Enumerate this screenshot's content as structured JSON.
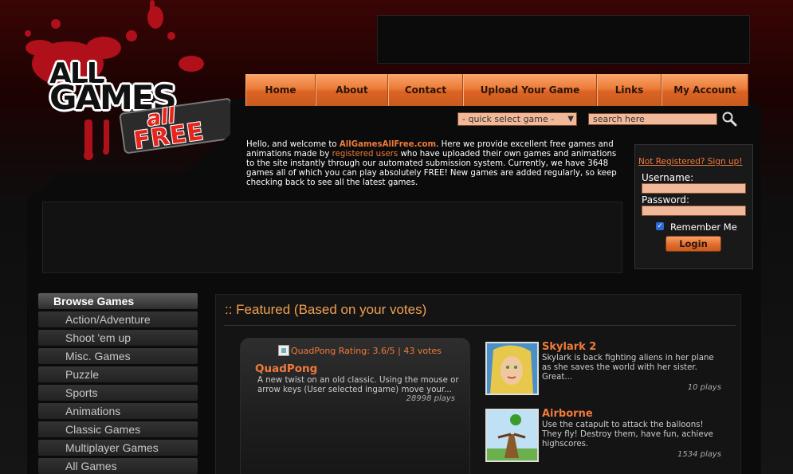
{
  "logo": {
    "line1": "ALL",
    "line2": "GAMES",
    "badge_line1": "all",
    "badge_line2": "FREE"
  },
  "nav": {
    "items": [
      "Home",
      "About",
      "Contact",
      "Upload Your Game",
      "Links",
      "My Account"
    ]
  },
  "quick_select": {
    "value": "- quick select game -"
  },
  "search": {
    "placeholder": "search here"
  },
  "welcome": {
    "t1": "Hello, and welcome to ",
    "site": "AllGamesAllFree.com",
    "t2": ". Here we provide excellent free games and animations made by ",
    "registered": "registered users",
    "t3": " who have uploaded their own games and animations to the site instantly through our automated submission system. Currently, we have 3648 games all of which you can play absolutely FREE! New games are added regularly, so keep checking back to see all the latest games."
  },
  "login": {
    "register_link": "Not Registered? Sign up!",
    "username_label": "Username:",
    "password_label": "Password:",
    "remember_label": "Remember Me",
    "login_button": "Login"
  },
  "browse": {
    "title": "Browse Games",
    "items": [
      "Action/Adventure",
      "Shoot 'em up",
      "Misc. Games",
      "Puzzle",
      "Sports",
      "Animations",
      "Classic Games",
      "Multiplayer Games",
      "All Games"
    ]
  },
  "featured": {
    "title": ":: Featured (Based on your votes)",
    "main": {
      "img_alt": "QuadPong",
      "rating": "Rating: 3.6/5 | 43 votes",
      "name": "QuadPong",
      "desc": "A new twist on an old classic. Using the mouse or arrow keys (User selected ingame) move your...",
      "plays": "28998 plays"
    },
    "games": [
      {
        "name": "Skylark 2",
        "desc": "Skylark is back fighting aliens in her plane as she saves the world with her sister. Great...",
        "plays": "10 plays"
      },
      {
        "name": "Airborne",
        "desc": "Use the catapult to attack the balloons! They fly! Destroy them, have fun, achieve highscores.",
        "plays": "1534 plays"
      }
    ]
  }
}
